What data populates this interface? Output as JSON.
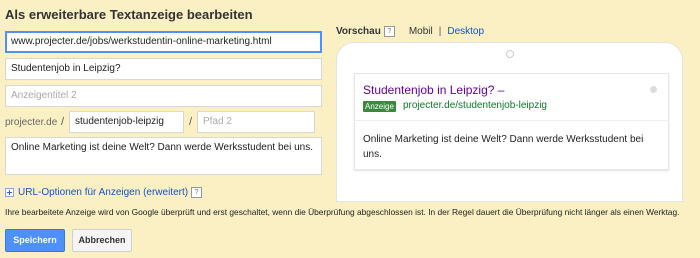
{
  "page": {
    "title": "Als erweiterbare Textanzeige bearbeiten"
  },
  "form": {
    "final_url": "www.projecter.de/jobs/werkstudentin-online-marketing.html",
    "headline1": "Studentenjob in Leipzig?",
    "headline2_placeholder": "Anzeigentitel 2",
    "domain_prefix": "projecter.de",
    "path_separator_1": "/",
    "path1": "studentenjob-leipzig",
    "path_separator_2": "/",
    "path2_placeholder": "Pfad 2",
    "description": "Online Marketing ist deine Welt? Dann werde Werksstudent bei uns."
  },
  "preview": {
    "label": "Vorschau",
    "help_icon": "?",
    "tab_mobile": "Mobil",
    "tab_separator": "|",
    "tab_desktop": "Desktop",
    "ad": {
      "headline": "Studentenjob in Leipzig? –",
      "badge": "Anzeige",
      "display_url": "projecter.de/studentenjob-leipzig",
      "description": "Online Marketing ist deine Welt? Dann werde Werksstudent bei uns."
    }
  },
  "url_options": {
    "label": "URL-Optionen für Anzeigen (erweitert)",
    "help_icon": "?"
  },
  "notice": "Ihre bearbeitete Anzeige wird von Google überprüft und erst geschaltet, wenn die Überprüfung abgeschlossen ist. In der Regel dauert die Überprüfung nicht länger als einen Werktag.",
  "buttons": {
    "save": "Speichern",
    "cancel": "Abbrechen"
  },
  "colors": {
    "background": "#fbf0c4",
    "primary": "#4d90fe",
    "ad_headline": "#660099",
    "ad_url": "#0a7a2a"
  }
}
